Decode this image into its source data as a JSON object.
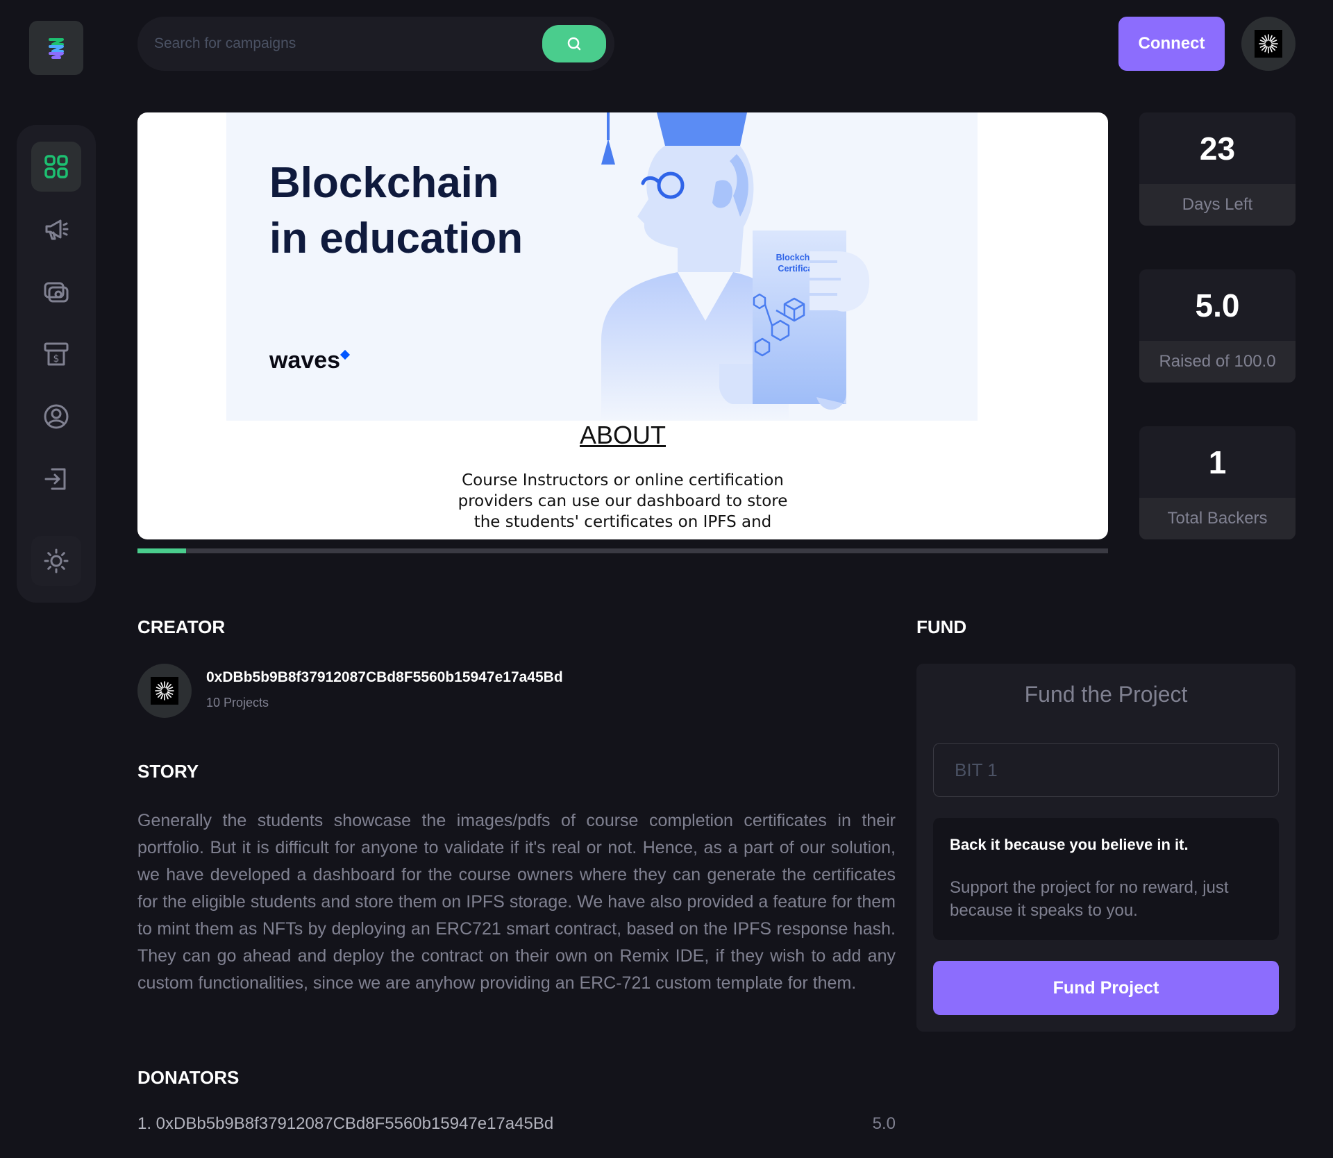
{
  "header": {
    "search_placeholder": "Search for campaigns",
    "connect_label": "Connect"
  },
  "sidebar": {
    "items": [
      {
        "name": "dashboard",
        "icon": "grid-icon",
        "active": true
      },
      {
        "name": "campaign",
        "icon": "megaphone-icon",
        "active": false
      },
      {
        "name": "payment",
        "icon": "wallet-icon",
        "active": false
      },
      {
        "name": "withdraw",
        "icon": "withdraw-icon",
        "active": false
      },
      {
        "name": "profile",
        "icon": "profile-icon",
        "active": false
      },
      {
        "name": "logout",
        "icon": "logout-icon",
        "active": false
      }
    ],
    "theme_icon": "sun-icon"
  },
  "hero": {
    "heading_line1": "Blockchain",
    "heading_line2": "in education",
    "brand": "waves",
    "certificate_line1": "Blockchain",
    "certificate_line2": "Certificate",
    "about_title": "ABOUT",
    "about_text": "Course Instructors or online certification providers can use our dashboard to store the students' certificates on IPFS and",
    "progress_percent": 5
  },
  "stats": [
    {
      "value": "23",
      "label": "Days Left"
    },
    {
      "value": "5.0",
      "label": "Raised of 100.0"
    },
    {
      "value": "1",
      "label": "Total Backers"
    }
  ],
  "creator": {
    "title": "Creator",
    "address": "0xDBb5b9B8f37912087CBd8F5560b15947e17a45Bd",
    "projects": "10 Projects"
  },
  "story": {
    "title": "Story",
    "text": "Generally the students showcase the images/pdfs of course completion certificates in their portfolio. But it is difficult for anyone to validate if it's real or not. Hence, as a part of our solution, we have developed a dashboard for the course owners where they can generate the certificates for the eligible students and store them on IPFS storage. We have also provided a feature for them to mint them as NFTs by deploying an ERC721 smart contract, based on the IPFS response hash. They can go ahead and deploy the contract on their own on Remix IDE, if they wish to add any custom functionalities, since we are anyhow providing an ERC-721 custom template for them."
  },
  "donators": {
    "title": "Donators",
    "list": [
      {
        "entry": "1. 0xDBb5b9B8f37912087CBd8F5560b15947e17a45Bd",
        "amount": "5.0"
      }
    ]
  },
  "fund": {
    "section_title": "Fund",
    "panel_title": "Fund the Project",
    "input_placeholder": "BIT 1",
    "info_title": "Back it because you believe in it.",
    "info_text": "Support the project for no reward, just because it speaks to you.",
    "button_label": "Fund Project"
  },
  "colors": {
    "background": "#13131a",
    "panel": "#1c1c24",
    "accent_green": "#4acd8d",
    "accent_purple": "#8c6dfd",
    "muted_text": "#808191"
  }
}
